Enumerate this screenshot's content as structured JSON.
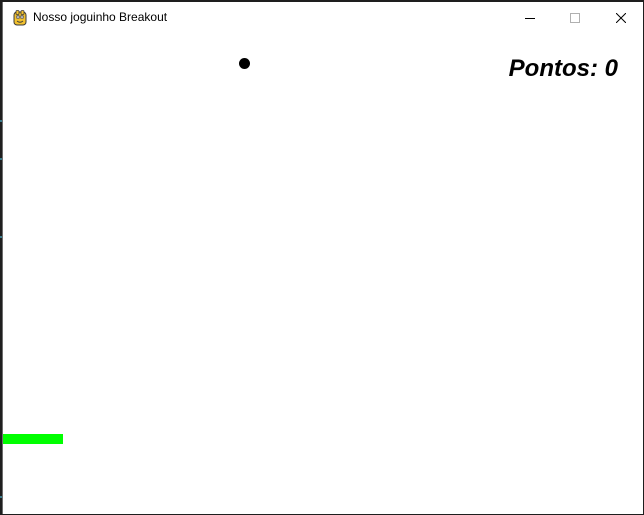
{
  "window": {
    "title": "Nosso joguinho Breakout",
    "app_icon": "pygame-snake-icon",
    "controls": {
      "minimize_icon": "minimize-icon",
      "maximize_icon": "maximize-icon",
      "close_icon": "close-icon"
    }
  },
  "game": {
    "score_text": "Pontos: 0",
    "colors": {
      "background": "#ffffff",
      "ball": "#000000",
      "paddle": "#00ff00",
      "score": "#000000"
    }
  }
}
